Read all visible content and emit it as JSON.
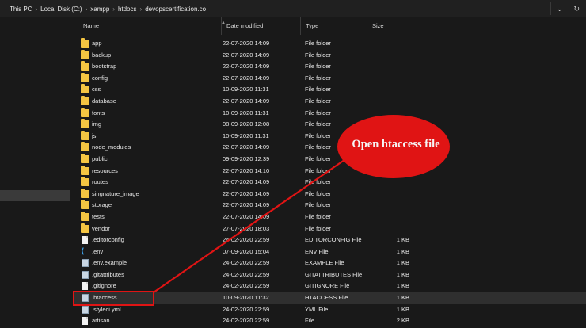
{
  "breadcrumb": {
    "items": [
      "This PC",
      "Local Disk (C:)",
      "xampp",
      "htdocs",
      "devopscertification.co"
    ],
    "separator": "›"
  },
  "window_controls": {
    "dropdown": "⌄",
    "refresh": "↻"
  },
  "columns": {
    "name": "Name",
    "date": "Date modified",
    "type": "Type",
    "size": "Size"
  },
  "files": [
    {
      "name": "app",
      "date": "22-07-2020 14:09",
      "type": "File folder",
      "size": "",
      "icon": "folder-icon"
    },
    {
      "name": "backup",
      "date": "22-07-2020 14:09",
      "type": "File folder",
      "size": "",
      "icon": "folder-icon"
    },
    {
      "name": "bootstrap",
      "date": "22-07-2020 14:09",
      "type": "File folder",
      "size": "",
      "icon": "folder-icon"
    },
    {
      "name": "config",
      "date": "22-07-2020 14:09",
      "type": "File folder",
      "size": "",
      "icon": "folder-icon"
    },
    {
      "name": "css",
      "date": "10-09-2020 11:31",
      "type": "File folder",
      "size": "",
      "icon": "folder-icon"
    },
    {
      "name": "database",
      "date": "22-07-2020 14:09",
      "type": "File folder",
      "size": "",
      "icon": "folder-icon"
    },
    {
      "name": "fonts",
      "date": "10-09-2020 11:31",
      "type": "File folder",
      "size": "",
      "icon": "folder-icon"
    },
    {
      "name": "img",
      "date": "08-09-2020 12:08",
      "type": "File folder",
      "size": "",
      "icon": "folder-icon"
    },
    {
      "name": "js",
      "date": "10-09-2020 11:31",
      "type": "File folder",
      "size": "",
      "icon": "folder-icon"
    },
    {
      "name": "node_modules",
      "date": "22-07-2020 14:09",
      "type": "File folder",
      "size": "",
      "icon": "folder-icon"
    },
    {
      "name": "public",
      "date": "09-09-2020 12:39",
      "type": "File folder",
      "size": "",
      "icon": "folder-icon"
    },
    {
      "name": "resources",
      "date": "22-07-2020 14:10",
      "type": "File folder",
      "size": "",
      "icon": "folder-icon"
    },
    {
      "name": "routes",
      "date": "22-07-2020 14:09",
      "type": "File folder",
      "size": "",
      "icon": "folder-icon"
    },
    {
      "name": "singnature_image",
      "date": "22-07-2020 14:09",
      "type": "File folder",
      "size": "",
      "icon": "folder-icon"
    },
    {
      "name": "storage",
      "date": "22-07-2020 14:09",
      "type": "File folder",
      "size": "",
      "icon": "folder-icon"
    },
    {
      "name": "tests",
      "date": "22-07-2020 14:09",
      "type": "File folder",
      "size": "",
      "icon": "folder-icon"
    },
    {
      "name": "vendor",
      "date": "27-07-2020 18:03",
      "type": "File folder",
      "size": "",
      "icon": "folder-icon"
    },
    {
      "name": ".editorconfig",
      "date": "24-02-2020 22:59",
      "type": "EDITORCONFIG File",
      "size": "1 KB",
      "icon": "file-icon"
    },
    {
      "name": ".env",
      "date": "07-09-2020 15:04",
      "type": "ENV File",
      "size": "1 KB",
      "icon": "vscode-icon"
    },
    {
      "name": ".env.example",
      "date": "24-02-2020 22:59",
      "type": "EXAMPLE File",
      "size": "1 KB",
      "icon": "generic-file-icon"
    },
    {
      "name": ".gitattributes",
      "date": "24-02-2020 22:59",
      "type": "GITATTRIBUTES File",
      "size": "1 KB",
      "icon": "generic-file-icon"
    },
    {
      "name": ".gitignore",
      "date": "24-02-2020 22:59",
      "type": "GITIGNORE File",
      "size": "1 KB",
      "icon": "file-icon"
    },
    {
      "name": ".htaccess",
      "date": "10-09-2020 11:32",
      "type": "HTACCESS File",
      "size": "1 KB",
      "icon": "generic-file-icon",
      "selected": true
    },
    {
      "name": ".styleci.yml",
      "date": "24-02-2020 22:59",
      "type": "YML File",
      "size": "1 KB",
      "icon": "generic-file-icon"
    },
    {
      "name": "artisan",
      "date": "24-02-2020 22:59",
      "type": "File",
      "size": "2 KB",
      "icon": "file-icon"
    }
  ],
  "annotation": {
    "callout_text": "Open htaccess file",
    "color": "#e01414"
  }
}
